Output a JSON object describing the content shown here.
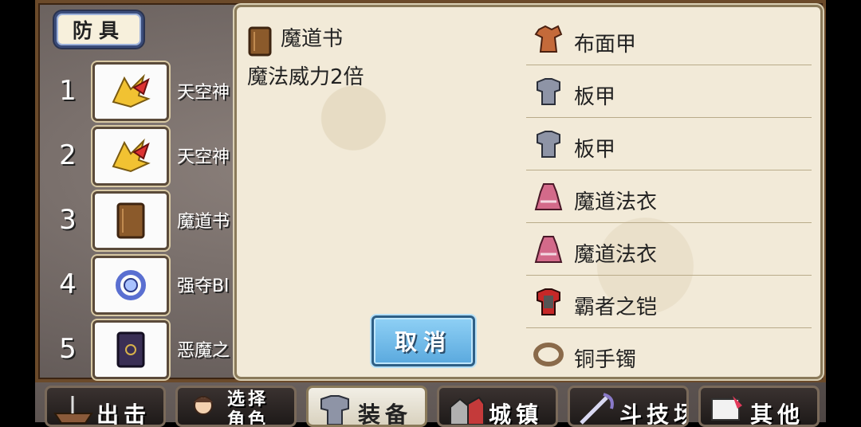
{
  "category": {
    "label": "防具"
  },
  "slots": [
    {
      "num": "1",
      "name": "天空神",
      "icon": "yellow-wings-icon"
    },
    {
      "num": "2",
      "name": "天空神",
      "icon": "yellow-wings-icon"
    },
    {
      "num": "3",
      "name": "魔道书",
      "icon": "book-icon"
    },
    {
      "num": "4",
      "name": "强夺Bl",
      "icon": "blue-ring-icon"
    },
    {
      "num": "5",
      "name": "恶魔之",
      "icon": "dark-book-icon"
    }
  ],
  "detail": {
    "name": "魔道书",
    "description": "魔法威力2倍",
    "icon": "book-icon"
  },
  "list": [
    {
      "label": "布面甲",
      "icon": "cloth-armor-icon"
    },
    {
      "label": "板甲",
      "icon": "plate-armor-icon"
    },
    {
      "label": "板甲",
      "icon": "plate-armor-icon"
    },
    {
      "label": "魔道法衣",
      "icon": "robe-icon"
    },
    {
      "label": "魔道法衣",
      "icon": "robe-icon"
    },
    {
      "label": "霸者之铠",
      "icon": "red-armor-icon"
    },
    {
      "label": "铜手镯",
      "icon": "bracelet-icon"
    }
  ],
  "cancel_label": "取消",
  "tabs": [
    {
      "label": "出击",
      "icon": "ship-icon"
    },
    {
      "label": "选择\n角色",
      "icon": "character-icon"
    },
    {
      "label": "装备",
      "icon": "armor-icon",
      "active": true
    },
    {
      "label": "城镇",
      "icon": "town-icon"
    },
    {
      "label": "斗技场",
      "icon": "sword-icon"
    },
    {
      "label": "其他",
      "icon": "scroll-icon"
    }
  ],
  "colors": {
    "panel_bg": "#f2ead8",
    "cancel_button": "#6fbbe9",
    "frame": "#6b4a2a"
  }
}
